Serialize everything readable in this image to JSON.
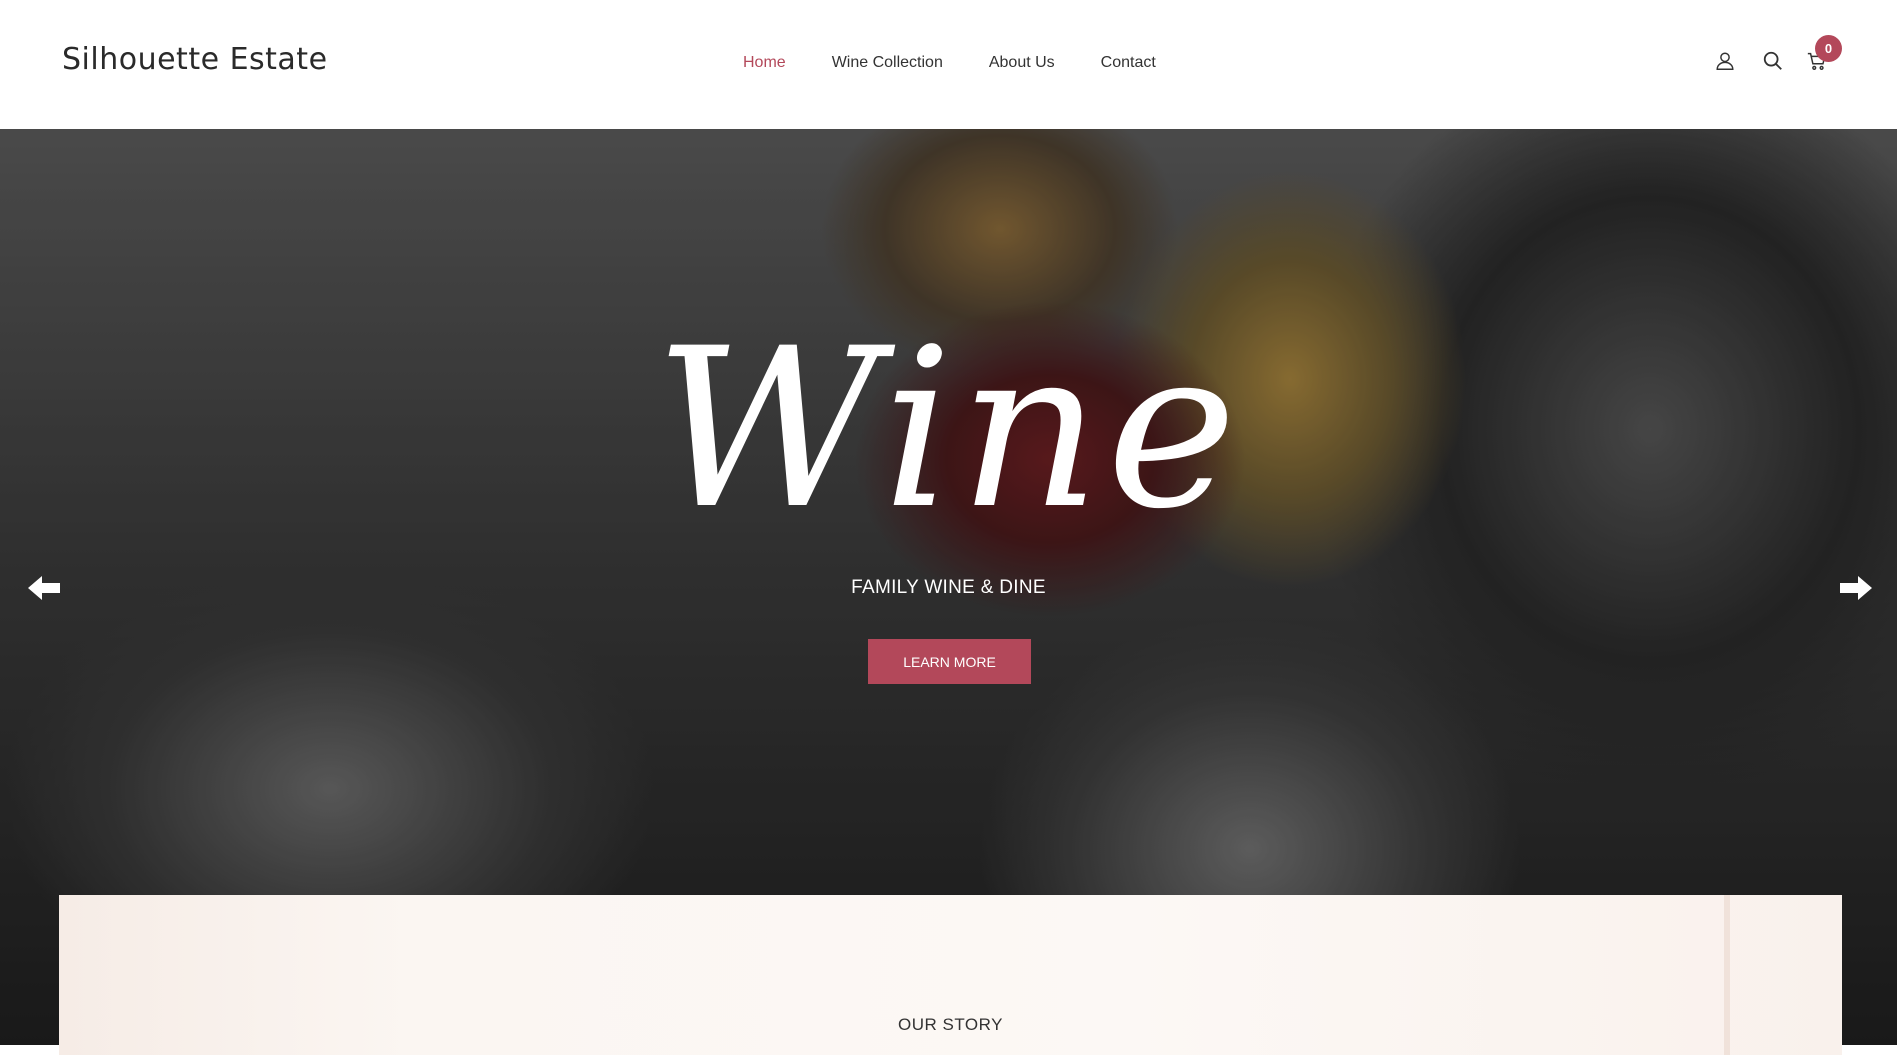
{
  "header": {
    "logo": "Silhouette Estate",
    "nav": [
      {
        "label": "Home",
        "active": true
      },
      {
        "label": "Wine Collection",
        "active": false
      },
      {
        "label": "About Us",
        "active": false
      },
      {
        "label": "Contact",
        "active": false
      }
    ],
    "icons": [
      "user-icon",
      "search-icon",
      "cart-icon"
    ],
    "cart_count": "0"
  },
  "hero": {
    "title": "Wine",
    "subtitle": "FAMILY WINE & DINE",
    "button_label": "LEARN MORE",
    "prev_icon": "arrow-left-icon",
    "next_icon": "arrow-right-icon"
  },
  "story": {
    "title": "OUR STORY"
  },
  "colors": {
    "accent": "#b3485a",
    "text": "#333333"
  }
}
